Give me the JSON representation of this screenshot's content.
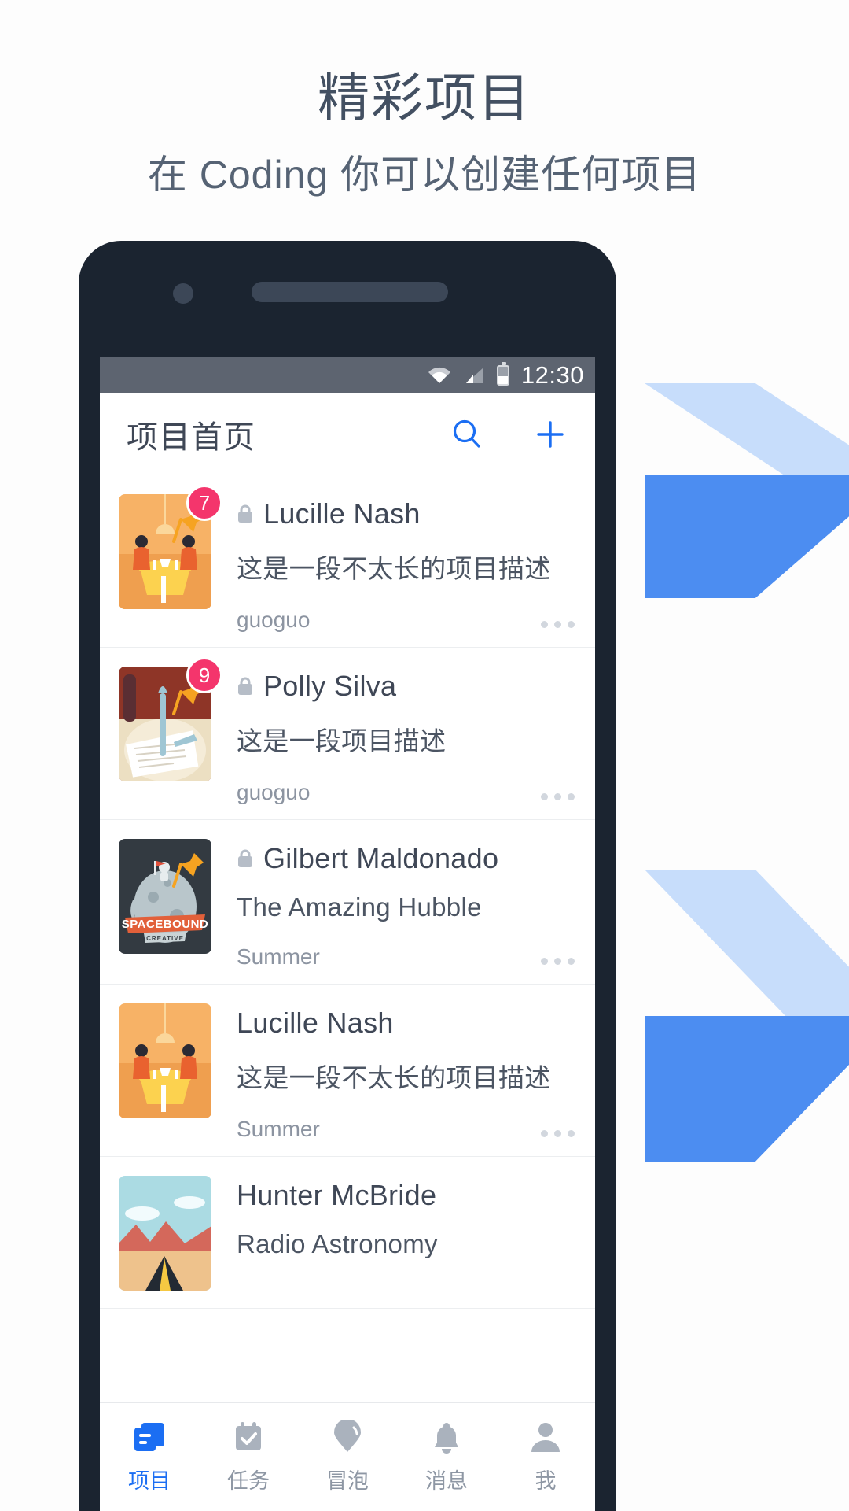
{
  "promo": {
    "headline": "精彩项目",
    "subhead": "在 Coding 你可以创建任何项目"
  },
  "colors": {
    "accent_blue": "#1b6ef3",
    "chevron_light": "#c7ddfb",
    "chevron_dark": "#4c8df1",
    "badge_pink": "#f4356c",
    "phone_body": "#1b2430",
    "statusbar": "#5d6470",
    "text_dark": "#3f4756",
    "text_muted": "#8c94a1"
  },
  "phone": {
    "statusbar": {
      "wifi_icon": "wifi-icon",
      "signal_icon": "cellular-signal-icon",
      "battery_icon": "battery-icon",
      "time": "12:30"
    },
    "appbar": {
      "title": "项目首页",
      "search_icon": "search-icon",
      "add_icon": "plus-icon"
    },
    "projects": [
      {
        "name": "Lucille Nash",
        "description": "这是一段不太长的项目描述",
        "owner": "guoguo",
        "badge": "7",
        "private": true,
        "pinned": true,
        "thumb": "dinner-table-illustration"
      },
      {
        "name": "Polly Silva",
        "description": "这是一段项目描述",
        "owner": "guoguo",
        "badge": "9",
        "private": true,
        "pinned": true,
        "thumb": "plate-fork-illustration"
      },
      {
        "name": "Gilbert Maldonado",
        "description": "The Amazing Hubble",
        "owner": "Summer",
        "badge": "",
        "private": true,
        "pinned": true,
        "thumb": "spacebound-creative-logo"
      },
      {
        "name": "Lucille Nash",
        "description": "这是一段不太长的项目描述",
        "owner": "Summer",
        "badge": "",
        "private": false,
        "pinned": false,
        "thumb": "dinner-table-illustration"
      },
      {
        "name": "Hunter McBride",
        "description": "Radio Astronomy",
        "owner": "",
        "badge": "",
        "private": false,
        "pinned": false,
        "thumb": "mountain-camp-illustration"
      }
    ],
    "tabs": [
      {
        "label": "项目",
        "icon": "projects-icon",
        "active": true
      },
      {
        "label": "任务",
        "icon": "task-calendar-icon",
        "active": false
      },
      {
        "label": "冒泡",
        "icon": "bubble-pin-icon",
        "active": false
      },
      {
        "label": "消息",
        "icon": "bell-icon",
        "active": false
      },
      {
        "label": "我",
        "icon": "person-icon",
        "active": false
      }
    ]
  }
}
